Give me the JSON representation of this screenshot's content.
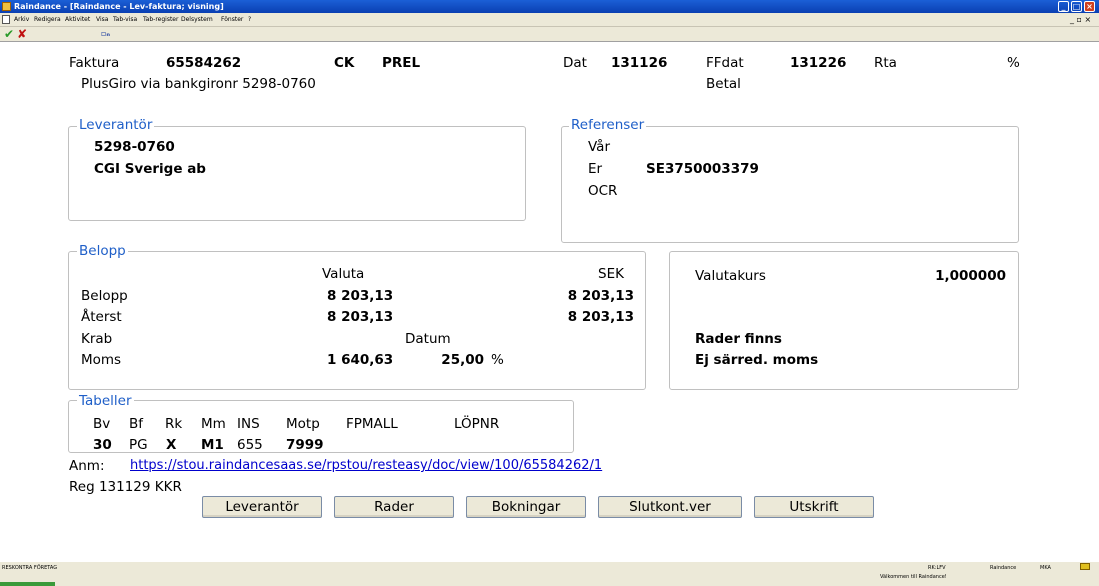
{
  "window": {
    "title": "Raindance - [Raindance - Lev-faktura; visning]"
  },
  "menu": {
    "items": [
      "Arkiv",
      "Redigera",
      "Aktivitet",
      "Visa",
      "Tab-visa",
      "Tab-register",
      "Delsystem",
      "Fönster",
      "?"
    ]
  },
  "toolbar": {
    "ok": "✔",
    "cancel": "✘"
  },
  "header": {
    "faktura_label": "Faktura",
    "faktura_nr": "65584262",
    "ck": "CK",
    "prel": "PREL",
    "dat_label": "Dat",
    "dat_value": "131126",
    "ffdat_label": "FFdat",
    "ffdat_value": "131226",
    "rta_label": "Rta",
    "percent": "%",
    "betal_label": "Betal",
    "pg_text": "PlusGiro via bankgironr 5298-0760"
  },
  "leverantor": {
    "legend": "Leverantör",
    "nr": "5298-0760",
    "name": "CGI Sverige ab"
  },
  "referenser": {
    "legend": "Referenser",
    "var_label": "Vår",
    "er_label": "Er",
    "er_value": "SE3750003379",
    "ocr_label": "OCR"
  },
  "belopp": {
    "legend": "Belopp",
    "valuta_header": "Valuta",
    "sek_header": "SEK",
    "belopp_label": "Belopp",
    "belopp_valuta": "8 203,13",
    "belopp_sek": "8 203,13",
    "aterst_label": "Återst",
    "aterst_valuta": "8 203,13",
    "aterst_sek": "8 203,13",
    "krab_label": "Krab",
    "datum_label": "Datum",
    "moms_label": "Moms",
    "moms_value": "1 640,63",
    "moms_pct": "25,00",
    "pct_sign": "%"
  },
  "valuta": {
    "kurs_label": "Valutakurs",
    "kurs_value": "1,000000",
    "rader_finns": "Rader finns",
    "ej_sarred": "Ej särred. moms"
  },
  "tabeller": {
    "legend": "Tabeller",
    "headers": [
      "Bv",
      "Bf",
      "Rk",
      "Mm",
      "INS",
      "Motp",
      "FPMALL",
      "LÖPNR"
    ],
    "values": [
      "30",
      "PG",
      "X",
      "M1",
      "655",
      "7999"
    ]
  },
  "anm": {
    "label": "Anm:",
    "link": "https://stou.raindancesaas.se/rpstou/resteasy/doc/view/100/65584262/1"
  },
  "reg": {
    "text": "Reg 131129 KKR"
  },
  "buttons": {
    "leverantor": "Leverantör",
    "rader": "Rader",
    "bokningar": "Bokningar",
    "slutkont": "Slutkont.ver",
    "utskrift": "Utskrift"
  },
  "status": {
    "left": "RESKONTRA FÖRETAG",
    "rk": "RK:LFV",
    "app": "Raindance",
    "user": "MKA",
    "welcome": "Välkommen till Raindance!"
  }
}
